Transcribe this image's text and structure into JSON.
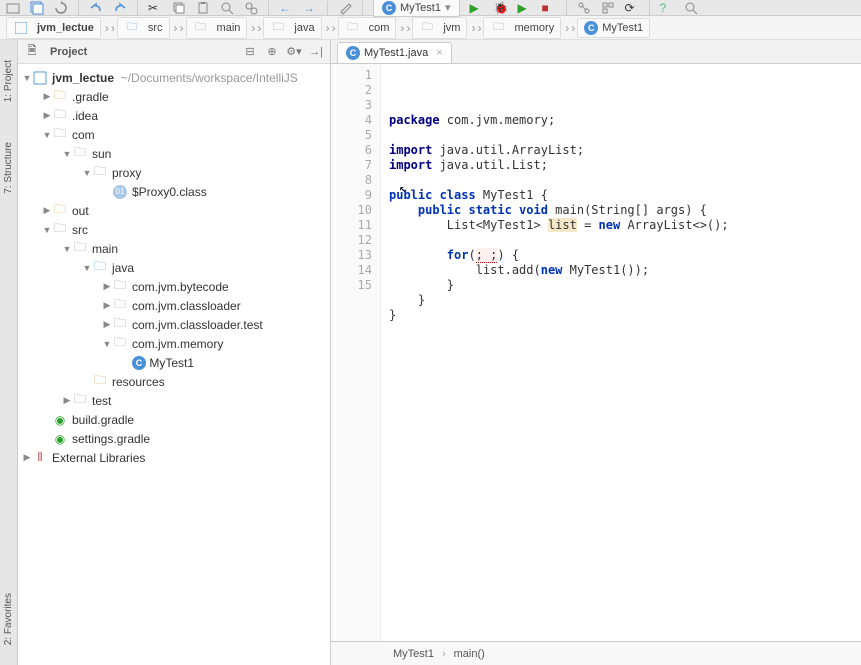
{
  "toolbar": {
    "run_target": "MyTest1"
  },
  "breadcrumb": {
    "items": [
      "jvm_lectue",
      "src",
      "main",
      "java",
      "com",
      "jvm",
      "memory",
      "MyTest1"
    ]
  },
  "project_panel": {
    "title": "Project",
    "root": "jvm_lectue",
    "root_path": "~/Documents/workspace/IntelliJS",
    "tree": {
      "gradle": ".gradle",
      "idea": ".idea",
      "com": "com",
      "sun": "sun",
      "proxy": "proxy",
      "proxy_class": "$Proxy0.class",
      "out": "out",
      "src": "src",
      "main": "main",
      "java": "java",
      "pkg_bytecode": "com.jvm.bytecode",
      "pkg_classloader": "com.jvm.classloader",
      "pkg_classloader_test": "com.jvm.classloader.test",
      "pkg_memory": "com.jvm.memory",
      "mytest1": "MyTest1",
      "resources": "resources",
      "test": "test",
      "build_gradle": "build.gradle",
      "settings_gradle": "settings.gradle",
      "external_libs": "External Libraries"
    }
  },
  "tabs": {
    "file": "MyTest1.java"
  },
  "code": {
    "lines": [
      {
        "n": 1,
        "pre": "",
        "tokens": [
          {
            "t": "package",
            "c": "kw2"
          },
          {
            "t": " com.jvm.memory;",
            "c": ""
          }
        ]
      },
      {
        "n": 2,
        "pre": "",
        "tokens": []
      },
      {
        "n": 3,
        "pre": "",
        "tokens": [
          {
            "t": "import",
            "c": "kw2"
          },
          {
            "t": " java.util.ArrayList;",
            "c": ""
          }
        ]
      },
      {
        "n": 4,
        "pre": "",
        "tokens": [
          {
            "t": "import",
            "c": "kw2"
          },
          {
            "t": " java.util.List;",
            "c": ""
          }
        ]
      },
      {
        "n": 5,
        "pre": "",
        "tokens": []
      },
      {
        "n": 6,
        "pre": "",
        "tokens": [
          {
            "t": "public class",
            "c": "kw"
          },
          {
            "t": " MyTest1 {",
            "c": ""
          }
        ],
        "run": true
      },
      {
        "n": 7,
        "pre": "    ",
        "tokens": [
          {
            "t": "public static void",
            "c": "kw"
          },
          {
            "t": " main(String[] args) {",
            "c": ""
          }
        ],
        "run": true
      },
      {
        "n": 8,
        "pre": "        ",
        "tokens": [
          {
            "t": "List<MyTest1> ",
            "c": ""
          },
          {
            "t": "list",
            "c": "hl"
          },
          {
            "t": " = ",
            "c": ""
          },
          {
            "t": "new",
            "c": "kw"
          },
          {
            "t": " ArrayList<>();",
            "c": ""
          }
        ],
        "hlrow": true
      },
      {
        "n": 9,
        "pre": "",
        "tokens": [],
        "hlrow2": true
      },
      {
        "n": 10,
        "pre": "        ",
        "tokens": [
          {
            "t": "for",
            "c": "kw"
          },
          {
            "t": "(",
            "c": ""
          },
          {
            "t": "; ;",
            "c": "hl-err"
          },
          {
            "t": ") {",
            "c": ""
          }
        ]
      },
      {
        "n": 11,
        "pre": "            ",
        "tokens": [
          {
            "t": "list.add(",
            "c": ""
          },
          {
            "t": "new",
            "c": "kw"
          },
          {
            "t": " MyTest1());",
            "c": ""
          }
        ]
      },
      {
        "n": 12,
        "pre": "        ",
        "tokens": [
          {
            "t": "}",
            "c": ""
          }
        ]
      },
      {
        "n": 13,
        "pre": "    ",
        "tokens": [
          {
            "t": "}",
            "c": ""
          }
        ]
      },
      {
        "n": 14,
        "pre": "",
        "tokens": [
          {
            "t": "}",
            "c": ""
          }
        ]
      },
      {
        "n": 15,
        "pre": "",
        "tokens": []
      }
    ]
  },
  "statusbar": {
    "context1": "MyTest1",
    "context2": "main()"
  },
  "gutter_labels": {
    "project": "1: Project",
    "structure": "7: Structure",
    "favorites": "2: Favorites"
  }
}
